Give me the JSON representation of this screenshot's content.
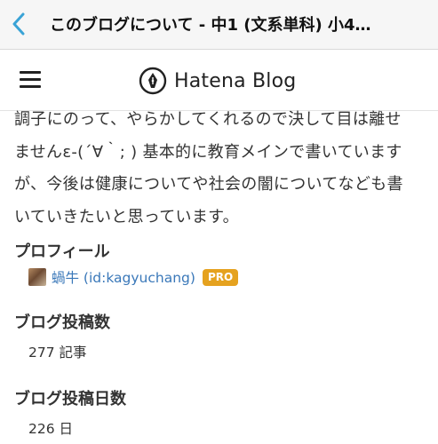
{
  "nav": {
    "title": "このブログについて - 中1 (文系単科) 小4…",
    "back_icon": "chevron-left-icon",
    "accent_color": "#3aa3d6"
  },
  "header": {
    "menu_icon": "hamburger-menu-icon",
    "logo_text": "Hatena Blog",
    "logo_icon": "pen-nib-icon"
  },
  "intro": {
    "lines": [
      "調子にのって、やらかしてくれるので決して目は離せ",
      "ませんε-(´∀｀; ) 基本的に教育メインで書いています",
      "が、今後は健康についてや社会の闇についてなども書",
      "いていきたいと思っています。"
    ]
  },
  "profile": {
    "heading": "プロフィール",
    "name": "蝸牛 (id:kagyuchang)",
    "badge": "PRO",
    "badge_color": "#e5a21f",
    "link_color": "#3a78b9"
  },
  "posts": {
    "heading": "ブログ投稿数",
    "value": "277 記事"
  },
  "days": {
    "heading": "ブログ投稿日数",
    "value": "226 日"
  }
}
